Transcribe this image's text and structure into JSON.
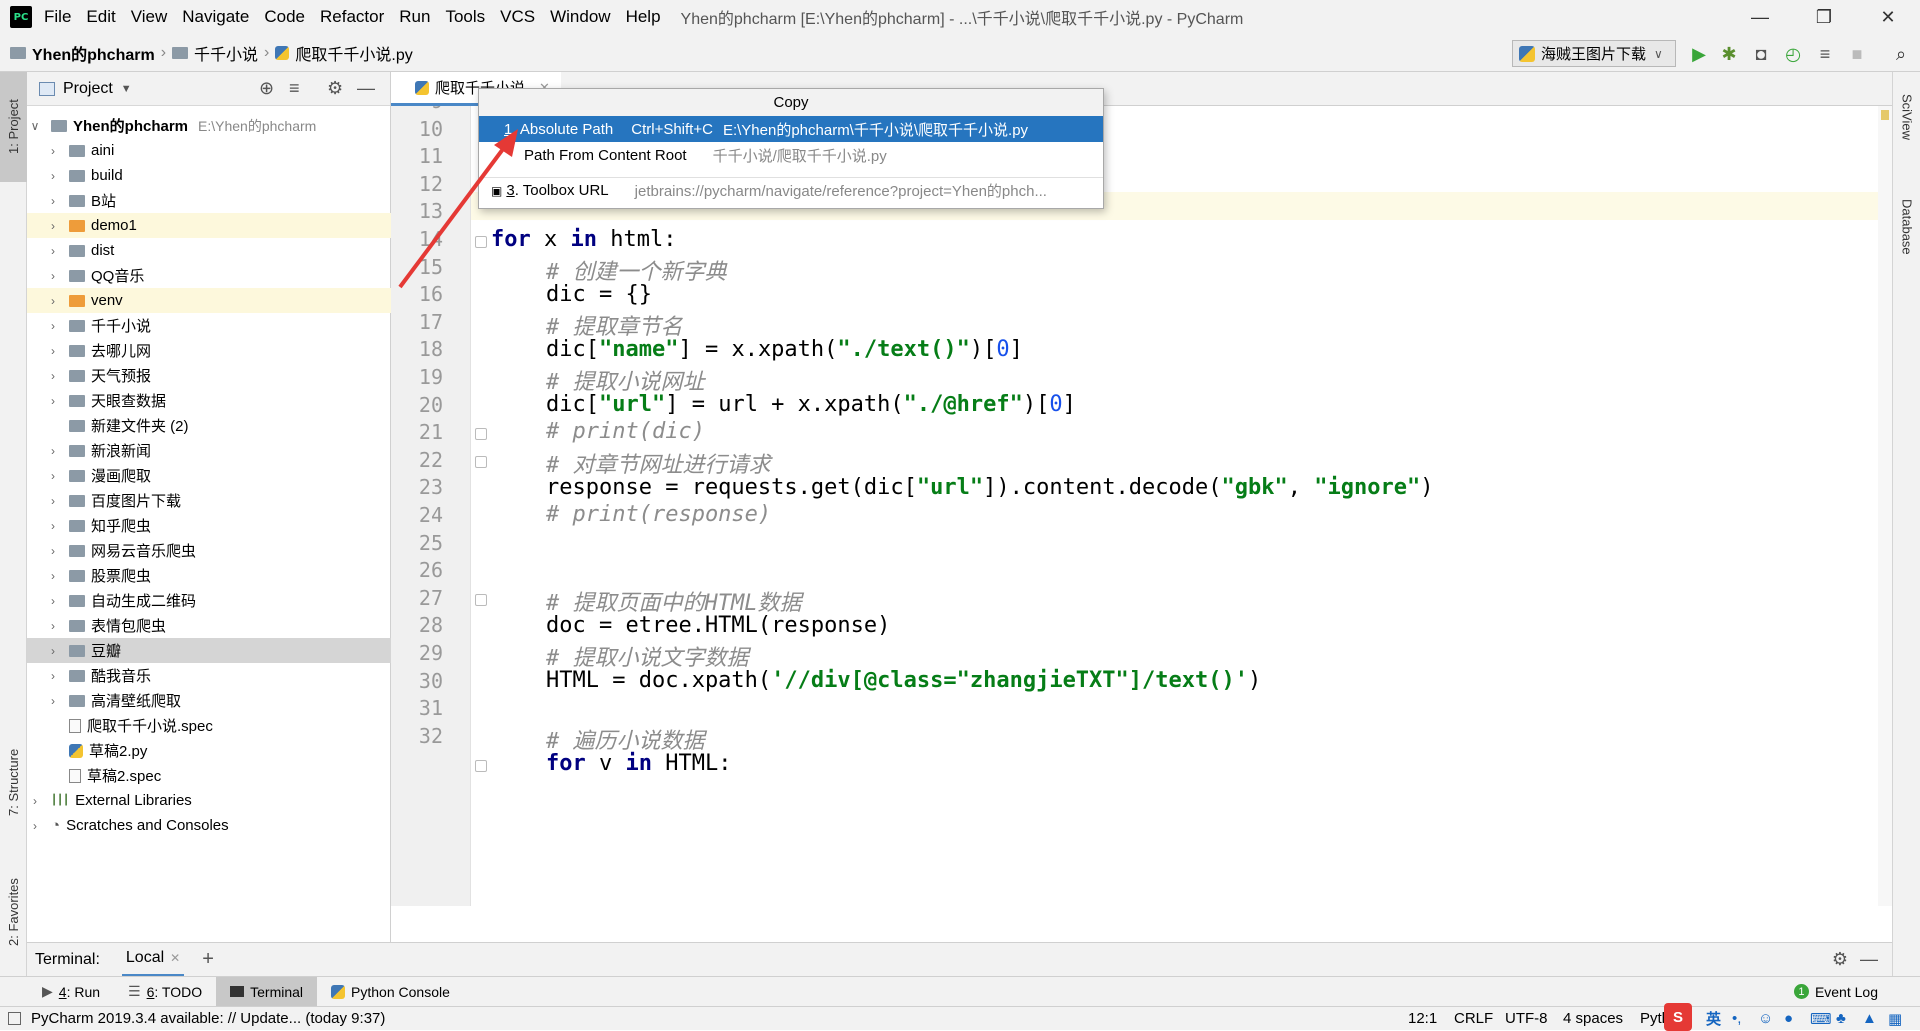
{
  "menubar": {
    "items": [
      "File",
      "Edit",
      "View",
      "Navigate",
      "Code",
      "Refactor",
      "Run",
      "Tools",
      "VCS",
      "Window",
      "Help"
    ],
    "title": "Yhen的phcharm [E:\\Yhen的phcharm] - ...\\千千小说\\爬取千千小说.py - PyCharm"
  },
  "navbar": {
    "project": "Yhen的phcharm",
    "folder": "千千小说",
    "file": "爬取千千小说.py",
    "run_config": "海贼王图片下载"
  },
  "left_strip": {
    "project_tab": "1: Project",
    "structure_tab": "7: Structure",
    "favorites_tab": "2: Favorites"
  },
  "right_strip": {
    "sciview_tab": "SciView",
    "database_tab": "Database"
  },
  "project_panel": {
    "title": "Project",
    "root_name": "Yhen的phcharm",
    "root_path": "E:\\Yhen的phcharm",
    "items": [
      {
        "label": "aini",
        "icon": "folder"
      },
      {
        "label": "build",
        "icon": "folder"
      },
      {
        "label": "B站",
        "icon": "folder"
      },
      {
        "label": "demo1",
        "icon": "folder-orange"
      },
      {
        "label": "dist",
        "icon": "folder"
      },
      {
        "label": "QQ音乐",
        "icon": "folder"
      },
      {
        "label": "venv",
        "icon": "folder-orange"
      },
      {
        "label": "千千小说",
        "icon": "folder"
      },
      {
        "label": "去哪儿网",
        "icon": "folder"
      },
      {
        "label": "天气预报",
        "icon": "folder"
      },
      {
        "label": "天眼查数据",
        "icon": "folder"
      },
      {
        "label": "新建文件夹 (2)",
        "icon": "folder"
      },
      {
        "label": "新浪新闻",
        "icon": "folder"
      },
      {
        "label": "漫画爬取",
        "icon": "folder"
      },
      {
        "label": "百度图片下载",
        "icon": "folder"
      },
      {
        "label": "知乎爬虫",
        "icon": "folder"
      },
      {
        "label": "网易云音乐爬虫",
        "icon": "folder"
      },
      {
        "label": "股票爬虫",
        "icon": "folder"
      },
      {
        "label": "自动生成二维码",
        "icon": "folder"
      },
      {
        "label": "表情包爬虫",
        "icon": "folder"
      },
      {
        "label": "豆瓣",
        "icon": "folder"
      },
      {
        "label": "酷我音乐",
        "icon": "folder"
      },
      {
        "label": "高清壁纸爬取",
        "icon": "folder"
      },
      {
        "label": "爬取千千小说.spec",
        "icon": "file"
      },
      {
        "label": "草稿2.py",
        "icon": "python-file"
      },
      {
        "label": "草稿2.spec",
        "icon": "file"
      }
    ],
    "external_libraries": "External Libraries",
    "scratches": "Scratches and Consoles"
  },
  "editor": {
    "tab_label": "爬取千千小说",
    "line_numbers": [
      "9",
      "10",
      "11",
      "12",
      "13",
      "14",
      "15",
      "16",
      "17",
      "18",
      "19",
      "20",
      "21",
      "22",
      "23",
      "24",
      "25",
      "26",
      "27",
      "28",
      "29",
      "30",
      "31",
      "32"
    ],
    "code_lines": {
      "l13_kw1": "for",
      "l13_rest1": " x ",
      "l13_kw2": "in",
      "l13_rest2": " html:",
      "l14": "# 创建一个新字典",
      "l15": "dic = {}",
      "l16": "# 提取章节名",
      "l17_a": "dic[",
      "l17_s1": "\"name\"",
      "l17_b": "] = x.xpath(",
      "l17_s2": "\"./text()\"",
      "l17_c": ")[",
      "l17_n": "0",
      "l17_d": "]",
      "l18": "# 提取小说网址",
      "l19_a": "dic[",
      "l19_s1": "\"url\"",
      "l19_b": "] = url + x.xpath(",
      "l19_s2": "\"./@href\"",
      "l19_c": ")[",
      "l19_n": "0",
      "l19_d": "]",
      "l20": "# print(dic)",
      "l21": "# 对章节网址进行请求",
      "l22_a": "response = requests.get(dic[",
      "l22_s1": "\"url\"",
      "l22_b": "]).content.decode(",
      "l22_s2": "\"gbk\"",
      "l22_c": ", ",
      "l22_s3": "\"ignore\"",
      "l22_d": ")",
      "l23": "# print(response)",
      "l26": "# 提取页面中的HTML数据",
      "l27": "doc = etree.HTML(response)",
      "l28": "# 提取小说文字数据",
      "l29_a": "HTML = doc.xpath(",
      "l29_s1": "'//div[@class=\"zhangjieTXT\"]/text()'",
      "l29_b": ")",
      "l31": "# 遍历小说数据",
      "l32_kw1": "for",
      "l32_rest1": " v ",
      "l32_kw2": "in",
      "l32_rest2": " HTML:"
    }
  },
  "copy_popup": {
    "header": "Copy",
    "rows": [
      {
        "num": "1",
        "label": ". Absolute Path",
        "shortcut": "Ctrl+Shift+C",
        "value": "E:\\Yhen的phcharm\\千千小说\\爬取千千小说.py"
      },
      {
        "num": "",
        "label": "Path From Content Root",
        "shortcut": "",
        "value": "千千小说/爬取千千小说.py"
      },
      {
        "num": "3",
        "label": ". Toolbox URL",
        "shortcut": "",
        "value": "jetbrains://pycharm/navigate/reference?project=Yhen的phch..."
      }
    ]
  },
  "terminal": {
    "label": "Terminal:",
    "tab": "Local",
    "add": "+"
  },
  "bottom_tabs": {
    "run_num": "4",
    "run": ": Run",
    "todo_num": "6",
    "todo": ": TODO",
    "terminal": "Terminal",
    "python_console": "Python Console",
    "event_log": "Event Log",
    "event_count": "1"
  },
  "status": {
    "message": "PyCharm 2019.3.4 available: // Update... (today 9:37)",
    "position": "12:1",
    "line_sep": "CRLF",
    "encoding": "UTF-8",
    "indent": "4 spaces",
    "interpreter": "Pyth",
    "ime": "英"
  },
  "colors": {
    "selection": "#2675bf",
    "arrow": "#e53935",
    "keyword": "#000080",
    "string": "#067d17",
    "comment": "#8c8c8c",
    "number": "#1750eb"
  }
}
